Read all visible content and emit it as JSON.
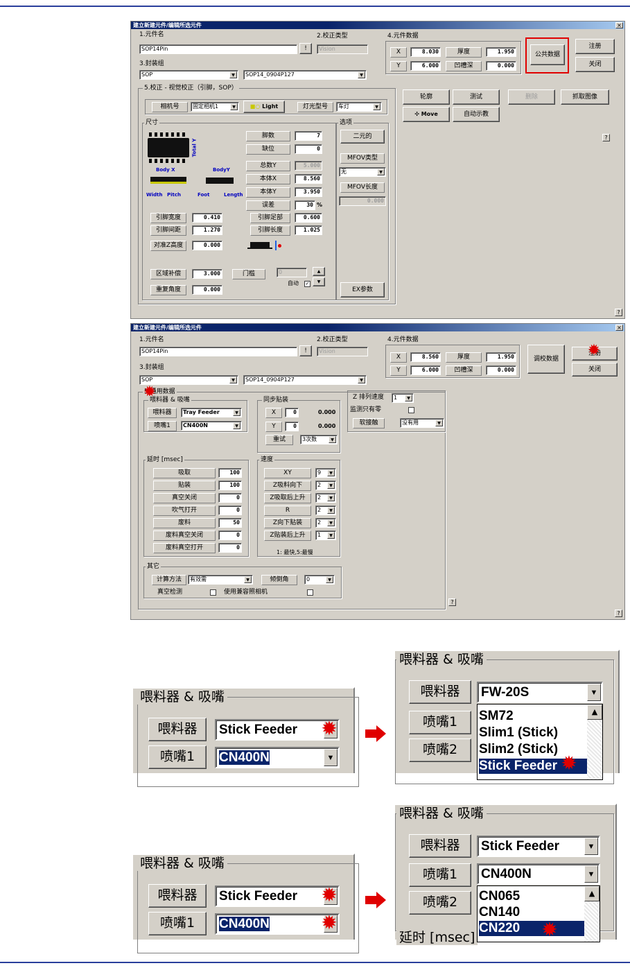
{
  "dialog1": {
    "title": "建立新建元件/编辑所选元件",
    "part_name_label": "1.元件名",
    "part_name_value": "SOP14Pin",
    "browse_btn": "!",
    "align_type_label": "2.校正类型",
    "align_type_value": "Vision",
    "part_data_label": "4.元件数据",
    "x_label": "X",
    "x_value": "8.030",
    "y_label": "Y",
    "y_value": "6.000",
    "thickness_label": "厚度",
    "thickness_value": "1.950",
    "recess_label": "凹槽深",
    "recess_value": "0.000",
    "common_data_btn": "公共数据",
    "register_btn": "注册",
    "close_btn": "关闭",
    "package_label": "3.封装组",
    "package_value": "SOP",
    "package_model": "SOP14_0904P127",
    "section5": "5.校正 - 视觉校正（引脚，SOP）",
    "camera_label": "相机号",
    "camera_value": "固定相机1",
    "light_btn": "Light",
    "lamp_label": "灯光型号",
    "lamp_value": "车灯",
    "outline_btn": "轮廓",
    "test_btn": "测试",
    "delete_btn": "删除",
    "capture_btn": "抓取图像",
    "move_btn": "Move",
    "auto_teach_btn": "自动示教",
    "size_group": "尺寸",
    "diagram_total_y": "Total Y",
    "diagram_body_x": "Body X",
    "diagram_body_y": "BodyY",
    "diagram_width": "Width",
    "diagram_pitch": "Pitch",
    "diagram_foot": "Foot",
    "diagram_length": "Length",
    "pin_count_label": "脚数",
    "pin_count_value": "7",
    "missing_label": "缺位",
    "missing_value": "0",
    "total_y_label": "总数Y",
    "total_y_value": "5.000",
    "body_x_label": "本体X",
    "body_x_value": "8.560",
    "body_y_label": "本体Y",
    "body_y_value": "3.950",
    "tolerance_label": "误差",
    "tolerance_value": "30",
    "tolerance_unit": "%",
    "lead_width_label": "引脚宽度",
    "lead_width_value": "0.410",
    "foot_label": "引脚足部",
    "foot_value": "0.600",
    "lead_pitch_label": "引脚间距",
    "lead_pitch_value": "1.270",
    "lead_len_label": "引脚长度",
    "lead_len_value": "1.025",
    "align_z_label": "对准Z高度",
    "align_z_value": "0.000",
    "area_comp_label": "区域补偿",
    "area_comp_value": "3.000",
    "threshold_label": "门槛",
    "threshold_value": "0",
    "auto_label": "自动",
    "repeat_angle_label": "重复角度",
    "repeat_angle_value": "0.000",
    "options_group": "选项",
    "binary_btn": "二元的",
    "mfov_type_label": "MFOV类型",
    "mfov_type_value": "无",
    "mfov_len_label": "MFOV长度",
    "mfov_len_value": "0.000",
    "ex_params_btn": "EX参数",
    "help": "?"
  },
  "dialog2": {
    "title": "建立新建元件/编辑所选元件",
    "part_name_label": "1.元件名",
    "part_name_value": "SOP14Pin",
    "browse_btn": "!",
    "align_type_label": "2.校正类型",
    "align_type_value": "Vision",
    "part_data_label": "4.元件数据",
    "x_label": "X",
    "x_value": "8.560",
    "y_label": "Y",
    "y_value": "6.000",
    "thickness_label": "厚度",
    "thickness_value": "1.950",
    "recess_label": "凹槽深",
    "recess_value": "0.000",
    "calib_btn": "调校数据",
    "register_btn": "注册",
    "close_btn": "关闭",
    "package_label": "3.封装组",
    "package_value": "SOP",
    "package_model": "SOP14_0904P127",
    "section5": "5.通用数据",
    "feeder_group": "喂料器 & 吸嘴",
    "feeder_label": "喂料器",
    "feeder_value": "Tray Feeder",
    "nozzle_label": "喷嘴1",
    "nozzle_value": "CN400N",
    "sync_group": "同步贴装",
    "sx_label": "X",
    "sx_value": "0",
    "sx_result": "0.000",
    "sy_label": "Y",
    "sy_value": "0",
    "sy_result": "0.000",
    "retry_label": "重试",
    "retry_value": "3次数",
    "z_speed_label": "Z 排列速度",
    "z_speed_value": "1",
    "monitor_label": "监测只有零",
    "soft_label": "软接触",
    "soft_value": "没有用",
    "delay_group": "延时 [msec]",
    "delays": [
      {
        "label": "吸取",
        "value": "100"
      },
      {
        "label": "贴装",
        "value": "100"
      },
      {
        "label": "真空关闭",
        "value": "0"
      },
      {
        "label": "吹气打开",
        "value": "0"
      },
      {
        "label": "废料",
        "value": "50"
      },
      {
        "label": "废料真空关闭",
        "value": "0"
      },
      {
        "label": "废料真空打开",
        "value": "0"
      }
    ],
    "speed_group": "速度",
    "speeds": [
      {
        "label": "XY",
        "value": "9"
      },
      {
        "label": "Z吸料向下",
        "value": "2"
      },
      {
        "label": "Z吸取后上升",
        "value": "2"
      },
      {
        "label": "R",
        "value": "2"
      },
      {
        "label": "Z向下贴装",
        "value": "2"
      },
      {
        "label": "Z贴装后上升",
        "value": "1"
      }
    ],
    "speed_note": "1: 最快,5:最慢",
    "other_group": "其它",
    "calc_label": "计算方法",
    "calc_value": "有效需",
    "tilt_label": "倾倒角",
    "tilt_value": "0",
    "vacuum_label": "真空检测",
    "compat_cam_label": "使用兼容照相机",
    "help": "?"
  },
  "zoom1_left": {
    "group": "喂料器 & 吸嘴",
    "feeder_label": "喂料器",
    "feeder_value": "Stick Feeder",
    "nozzle_label": "喷嘴1",
    "nozzle_value": "CN400N"
  },
  "zoom1_right": {
    "group": "喂料器 & 吸嘴",
    "feeder_label": "喂料器",
    "feeder_value": "FW-20S",
    "nozzle1_label": "喷嘴1",
    "nozzle2_label": "喷嘴2",
    "options": [
      "SM72",
      "Slim1 (Stick)",
      "Slim2 (Stick)",
      "Stick Feeder"
    ]
  },
  "zoom2_left": {
    "group": "喂料器 & 吸嘴",
    "feeder_label": "喂料器",
    "feeder_value": "Stick Feeder",
    "nozzle_label": "喷嘴1",
    "nozzle_value": "CN400N"
  },
  "zoom2_right": {
    "group": "喂料器 & 吸嘴",
    "feeder_label": "喂料器",
    "feeder_value": "Stick Feeder",
    "nozzle1_label": "喷嘴1",
    "nozzle1_value": "CN400N",
    "nozzle2_label": "喷嘴2",
    "options": [
      "CN065",
      "CN140",
      "CN220"
    ],
    "cut_label": "延时 [msec]"
  },
  "colors": {
    "highlight": "#e00000",
    "selection": "#0a246a",
    "rule": "#2a3f9c",
    "dialog": "#d4d0c8"
  }
}
